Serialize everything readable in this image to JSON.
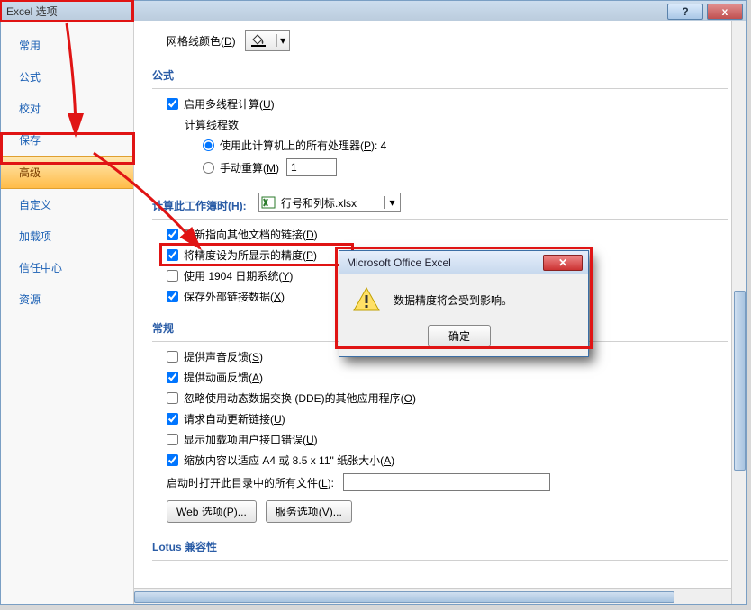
{
  "title": "Excel 选项",
  "titlebar": {
    "help": "?",
    "close": "x"
  },
  "sidebar": {
    "items": [
      {
        "label": "常用"
      },
      {
        "label": "公式"
      },
      {
        "label": "校对"
      },
      {
        "label": "保存"
      },
      {
        "label": "高级"
      },
      {
        "label": "自定义"
      },
      {
        "label": "加载项"
      },
      {
        "label": "信任中心"
      },
      {
        "label": "资源"
      }
    ]
  },
  "gridline_color_label": "网格线颜色(",
  "gridline_color_key": "D",
  "gridline_color_label_end": ")",
  "section_formula": "公式",
  "multithread_label": "启用多线程计算(",
  "multithread_key": "U",
  "threads_label": "计算线程数",
  "use_all_cpu_label": "使用此计算机上的所有处理器(",
  "use_all_cpu_key": "P",
  "use_all_cpu_end": "):   4",
  "manual_label": "手动重算(",
  "manual_key": "M",
  "manual_value": "1",
  "section_workbook": "计算此工作簿时(",
  "section_workbook_key": "H",
  "section_workbook_end": "):",
  "workbook_file": "行号和列标.xlsx",
  "update_links_label": "更新指向其他文档的链接(",
  "update_links_key": "D",
  "precision_label": "将精度设为所显示的精度(",
  "precision_key": "P",
  "date1904_label": "使用 1904 日期系统(",
  "date1904_key": "Y",
  "save_ext_label": "保存外部链接数据(",
  "save_ext_key": "X",
  "section_general": "常规",
  "sound_label": "提供声音反馈(",
  "sound_key": "S",
  "anim_label": "提供动画反馈(",
  "anim_key": "A",
  "dde_label": "忽略使用动态数据交换 (DDE)的其他应用程序(",
  "dde_key": "O",
  "autoup_label": "请求自动更新链接(",
  "autoup_key": "U",
  "addin_err_label": "显示加载项用户接口错误(",
  "addin_err_key": "U",
  "a4_label": "缩放内容以适应 A4 或 8.5 x 11\" 纸张大小(",
  "a4_key": "A",
  "startup_label": "启动时打开此目录中的所有文件(",
  "startup_key": "L",
  "startup_end": "):",
  "web_btn": "Web 选项(P)...",
  "service_btn": "服务选项(V)...",
  "section_lotus": "Lotus 兼容性",
  "dialog": {
    "title": "Microsoft Office Excel",
    "message": "数据精度将会受到影响。",
    "ok": "确定"
  },
  "paren_end": ")"
}
